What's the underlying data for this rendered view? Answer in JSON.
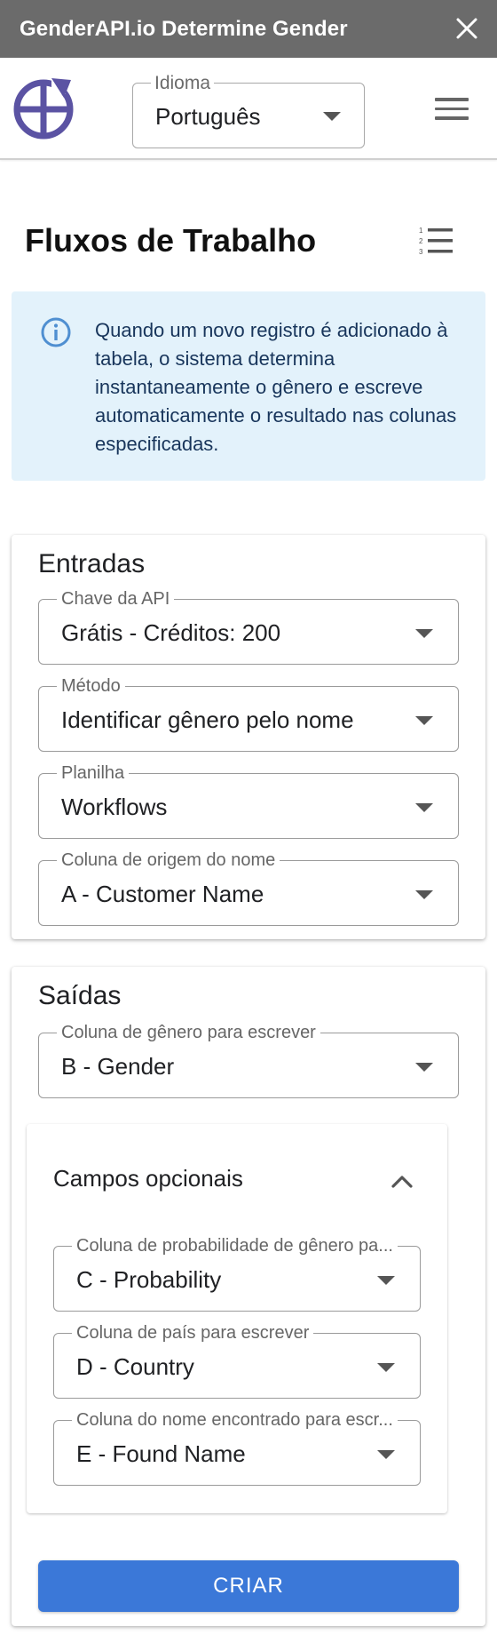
{
  "titlebar": {
    "title": "GenderAPI.io Determine Gender"
  },
  "header": {
    "language": {
      "label": "Idioma",
      "value": "Português"
    }
  },
  "page": {
    "title": "Fluxos de Trabalho"
  },
  "info": {
    "text": "Quando um novo registro é adicionado à tabela, o sistema determina instantaneamente o gênero e escreve automaticamente o resultado nas colunas especificadas."
  },
  "inputs": {
    "title": "Entradas",
    "api_key": {
      "label": "Chave da API",
      "value": "Grátis - Créditos: 200"
    },
    "method": {
      "label": "Método",
      "value": "Identificar gênero pelo nome"
    },
    "sheet": {
      "label": "Planilha",
      "value": "Workflows"
    },
    "name_column": {
      "label": "Coluna de origem do nome",
      "value": "A - Customer Name"
    }
  },
  "outputs": {
    "title": "Saídas",
    "gender_column": {
      "label": "Coluna de gênero para escrever",
      "value": "B - Gender"
    },
    "optional": {
      "title": "Campos opcionais",
      "probability_column": {
        "label": "Coluna de probabilidade de gênero pa...",
        "value": "C - Probability"
      },
      "country_column": {
        "label": "Coluna de país para escrever",
        "value": "D - Country"
      },
      "found_name_column": {
        "label": "Coluna do nome encontrado para escr...",
        "value": "E - Found Name"
      }
    },
    "create_label": "CRIAR"
  },
  "colors": {
    "titlebar": "#6b6b6b",
    "brand_logo": "#5b53a3",
    "info_bg": "#e3f2fb",
    "info_icon": "#4f8fd1",
    "primary_button": "#3b78d8"
  },
  "icons": {
    "close": "close-icon",
    "logo": "genderapi-logo-icon",
    "menu": "hamburger-menu-icon",
    "list": "numbered-list-icon",
    "info": "info-icon",
    "dropdown": "caret-down-icon",
    "collapse": "chevron-up-icon"
  }
}
